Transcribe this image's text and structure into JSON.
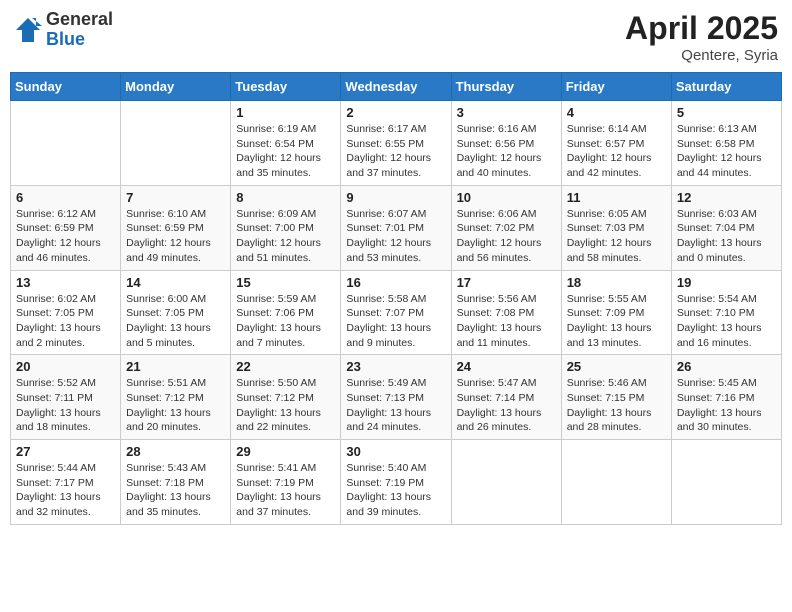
{
  "header": {
    "logo_general": "General",
    "logo_blue": "Blue",
    "title_month": "April 2025",
    "title_location": "Qentere, Syria"
  },
  "weekdays": [
    "Sunday",
    "Monday",
    "Tuesday",
    "Wednesday",
    "Thursday",
    "Friday",
    "Saturday"
  ],
  "weeks": [
    [
      {
        "day": null
      },
      {
        "day": null
      },
      {
        "day": "1",
        "sunrise": "6:19 AM",
        "sunset": "6:54 PM",
        "daylight": "12 hours and 35 minutes."
      },
      {
        "day": "2",
        "sunrise": "6:17 AM",
        "sunset": "6:55 PM",
        "daylight": "12 hours and 37 minutes."
      },
      {
        "day": "3",
        "sunrise": "6:16 AM",
        "sunset": "6:56 PM",
        "daylight": "12 hours and 40 minutes."
      },
      {
        "day": "4",
        "sunrise": "6:14 AM",
        "sunset": "6:57 PM",
        "daylight": "12 hours and 42 minutes."
      },
      {
        "day": "5",
        "sunrise": "6:13 AM",
        "sunset": "6:58 PM",
        "daylight": "12 hours and 44 minutes."
      }
    ],
    [
      {
        "day": "6",
        "sunrise": "6:12 AM",
        "sunset": "6:59 PM",
        "daylight": "12 hours and 46 minutes."
      },
      {
        "day": "7",
        "sunrise": "6:10 AM",
        "sunset": "6:59 PM",
        "daylight": "12 hours and 49 minutes."
      },
      {
        "day": "8",
        "sunrise": "6:09 AM",
        "sunset": "7:00 PM",
        "daylight": "12 hours and 51 minutes."
      },
      {
        "day": "9",
        "sunrise": "6:07 AM",
        "sunset": "7:01 PM",
        "daylight": "12 hours and 53 minutes."
      },
      {
        "day": "10",
        "sunrise": "6:06 AM",
        "sunset": "7:02 PM",
        "daylight": "12 hours and 56 minutes."
      },
      {
        "day": "11",
        "sunrise": "6:05 AM",
        "sunset": "7:03 PM",
        "daylight": "12 hours and 58 minutes."
      },
      {
        "day": "12",
        "sunrise": "6:03 AM",
        "sunset": "7:04 PM",
        "daylight": "13 hours and 0 minutes."
      }
    ],
    [
      {
        "day": "13",
        "sunrise": "6:02 AM",
        "sunset": "7:05 PM",
        "daylight": "13 hours and 2 minutes."
      },
      {
        "day": "14",
        "sunrise": "6:00 AM",
        "sunset": "7:05 PM",
        "daylight": "13 hours and 5 minutes."
      },
      {
        "day": "15",
        "sunrise": "5:59 AM",
        "sunset": "7:06 PM",
        "daylight": "13 hours and 7 minutes."
      },
      {
        "day": "16",
        "sunrise": "5:58 AM",
        "sunset": "7:07 PM",
        "daylight": "13 hours and 9 minutes."
      },
      {
        "day": "17",
        "sunrise": "5:56 AM",
        "sunset": "7:08 PM",
        "daylight": "13 hours and 11 minutes."
      },
      {
        "day": "18",
        "sunrise": "5:55 AM",
        "sunset": "7:09 PM",
        "daylight": "13 hours and 13 minutes."
      },
      {
        "day": "19",
        "sunrise": "5:54 AM",
        "sunset": "7:10 PM",
        "daylight": "13 hours and 16 minutes."
      }
    ],
    [
      {
        "day": "20",
        "sunrise": "5:52 AM",
        "sunset": "7:11 PM",
        "daylight": "13 hours and 18 minutes."
      },
      {
        "day": "21",
        "sunrise": "5:51 AM",
        "sunset": "7:12 PM",
        "daylight": "13 hours and 20 minutes."
      },
      {
        "day": "22",
        "sunrise": "5:50 AM",
        "sunset": "7:12 PM",
        "daylight": "13 hours and 22 minutes."
      },
      {
        "day": "23",
        "sunrise": "5:49 AM",
        "sunset": "7:13 PM",
        "daylight": "13 hours and 24 minutes."
      },
      {
        "day": "24",
        "sunrise": "5:47 AM",
        "sunset": "7:14 PM",
        "daylight": "13 hours and 26 minutes."
      },
      {
        "day": "25",
        "sunrise": "5:46 AM",
        "sunset": "7:15 PM",
        "daylight": "13 hours and 28 minutes."
      },
      {
        "day": "26",
        "sunrise": "5:45 AM",
        "sunset": "7:16 PM",
        "daylight": "13 hours and 30 minutes."
      }
    ],
    [
      {
        "day": "27",
        "sunrise": "5:44 AM",
        "sunset": "7:17 PM",
        "daylight": "13 hours and 32 minutes."
      },
      {
        "day": "28",
        "sunrise": "5:43 AM",
        "sunset": "7:18 PM",
        "daylight": "13 hours and 35 minutes."
      },
      {
        "day": "29",
        "sunrise": "5:41 AM",
        "sunset": "7:19 PM",
        "daylight": "13 hours and 37 minutes."
      },
      {
        "day": "30",
        "sunrise": "5:40 AM",
        "sunset": "7:19 PM",
        "daylight": "13 hours and 39 minutes."
      },
      {
        "day": null
      },
      {
        "day": null
      },
      {
        "day": null
      }
    ]
  ],
  "labels": {
    "sunrise_prefix": "Sunrise: ",
    "sunset_prefix": "Sunset: ",
    "daylight_prefix": "Daylight: "
  }
}
